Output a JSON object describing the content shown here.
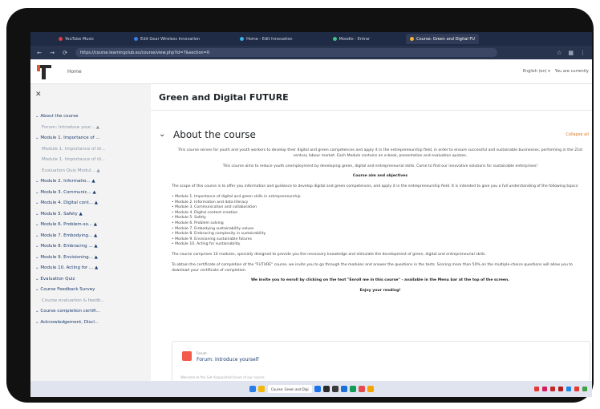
{
  "browser": {
    "tabs": [
      {
        "label": "YouTube Music",
        "color": "#e33b3b"
      },
      {
        "label": "Edit Gear Wireless Innovation",
        "color": "#3b7de3"
      },
      {
        "label": "Home - Edit Innovation",
        "color": "#3bb0e3"
      },
      {
        "label": "Moodle - Entrar",
        "color": "#43c08a"
      },
      {
        "label": "Course: Green and Digital FU",
        "color": "#f2b233",
        "active": true
      }
    ],
    "url": "https://course.learningclub.eu/course/view.php?id=7&section=0"
  },
  "site": {
    "home": "Home",
    "language": "English (en) ▾",
    "login_status": "You are currently"
  },
  "sidebar": {
    "items": [
      {
        "label": "About the course",
        "type": "section"
      },
      {
        "label": "Forum: Introduce your... ▲",
        "type": "sub"
      },
      {
        "label": "Module 1. Importance of ...",
        "type": "section"
      },
      {
        "label": "Module 1. Importance of di...",
        "type": "sub"
      },
      {
        "label": "Module 1. Importance of di...",
        "type": "sub"
      },
      {
        "label": "Evaluation Quiz Modul... ▲",
        "type": "sub"
      },
      {
        "label": "Module 2. Informatio... ▲",
        "type": "section"
      },
      {
        "label": "Module 3. Communic... ▲",
        "type": "section"
      },
      {
        "label": "Module 4. Digital cont... ▲",
        "type": "section"
      },
      {
        "label": "Module 5. Safety ▲",
        "type": "section"
      },
      {
        "label": "Module 6. Problem-so... ▲",
        "type": "section"
      },
      {
        "label": "Module 7. Embodying... ▲",
        "type": "section"
      },
      {
        "label": "Module 8. Embracing ... ▲",
        "type": "section"
      },
      {
        "label": "Module 9. Envisioning... ▲",
        "type": "section"
      },
      {
        "label": "Module 10. Acting for ... ▲",
        "type": "section"
      },
      {
        "label": "Evaluation Quiz",
        "type": "section"
      },
      {
        "label": "Course Feedback Survey",
        "type": "section"
      },
      {
        "label": "Course evaluation & feedb...",
        "type": "sub"
      },
      {
        "label": "Course completion certifi...",
        "type": "section"
      },
      {
        "label": "Acknowledgement, Discl...",
        "type": "section"
      }
    ]
  },
  "main": {
    "course_title": "Green and Digital FUTURE",
    "section_title": "About the course",
    "collapse_label": "Collapse all",
    "intro1": "This course serves for youth and youth workers to develop their digital and green competences and apply it in the entrepreneurship field, in order to ensure successful and sustainable businesses, performing in the 21st century labour market. Each Module contains an e-book, presentation and evaluation quizzes.",
    "intro2": "This course aims to reduce youth unemployment by developing green, digital and entrepreneurial skills. Come to find our innovative solutions for sustainable enterprises!",
    "aim_heading": "Course aim and objectives",
    "scope": "The scope of this course is to offer you information and guidance to develop digital and green competences, and apply it in the entrepreneurship field. It is intended to give you a full understanding of the following topics:",
    "modules": [
      "Module 1. Importance of digital and green skills in entrepreneurship",
      "Module 2. Information and data literacy",
      "Module 3. Communication and collaboration",
      "Module 4. Digital content creation",
      "Module 5. Safety",
      "Module 6. Problem solving",
      "Module 7. Embodying sustainability values",
      "Module 8. Embracing complexity in sustainability",
      "Module 9. Envisioning sustainable futures",
      "Module 10. Acting for sustainability"
    ],
    "comprises": "The course comprises 10 modules, specially designed to provide you the necessary knowledge and stimulate the development of green, digital and entrepreneurial skills.",
    "certificate": "To obtain the certificate of completion of the \"FUTURE\" course, we invite you to go through the modules and answer the questions in the tests. Scoring more than 50% on the multiple-choice questions will allow you to download your certificate of completion.",
    "enroll": "We invite you to enroll by clicking on the text \"Enroll me in this course\" - available in the Menu bar at the top of the screen.",
    "enjoy": "Enjoy your reading!",
    "forum_small": "Forum",
    "forum_name": "Forum: Introduce yourself",
    "forum_text": "Welcome to the Get Acquainted forum of our course"
  },
  "taskbar": {
    "app_label": "Course: Green and Digi"
  }
}
